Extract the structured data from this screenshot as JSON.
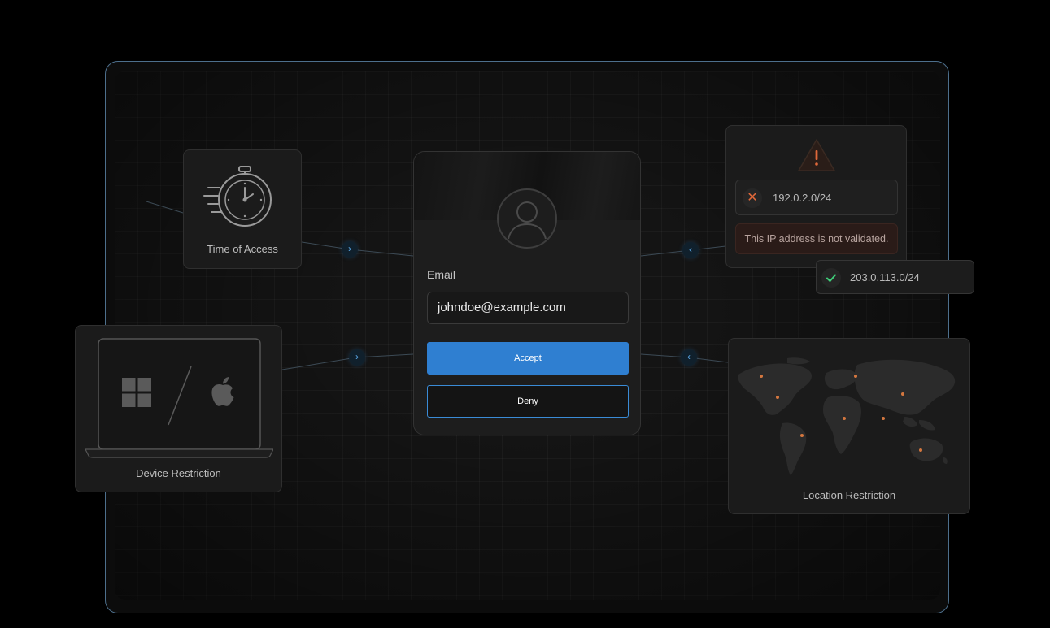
{
  "time_card": {
    "label": "Time of Access",
    "icon": "stopwatch-icon"
  },
  "device_card": {
    "label": "Device Restriction",
    "icons": [
      "windows-icon",
      "apple-icon"
    ]
  },
  "login": {
    "avatar_icon": "user-icon",
    "email_label": "Email",
    "email_value": "johndoe@example.com",
    "accept_label": "Accept",
    "deny_label": "Deny"
  },
  "ip_check": {
    "warning_icon": "warning-icon",
    "blocked_ip": "192.0.2.0/24",
    "blocked_message": "This IP address is not validated.",
    "allowed_ip": "203.0.113.0/24"
  },
  "location_card": {
    "label": "Location Restriction",
    "icon": "world-map-icon"
  },
  "colors": {
    "accent": "#2f7fd1",
    "warning": "#e0683a",
    "success": "#3fd07a",
    "frame_border": "#4d6f8c"
  }
}
